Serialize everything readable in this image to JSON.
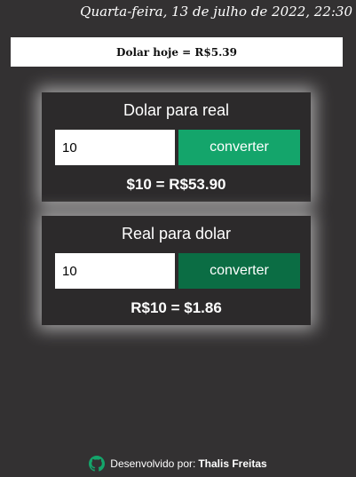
{
  "header": {
    "date": "Quarta-feira, 13 de julho de 2022, 22:30"
  },
  "rate_bar": {
    "text": "Dolar hoje = R$5.39"
  },
  "usd_to_brl": {
    "title": "Dolar para real",
    "input_value": "10",
    "button_label": "converter",
    "result": "$10 = R$53.90",
    "button_color": "#14a56b"
  },
  "brl_to_usd": {
    "title": "Real para dolar",
    "input_value": "10",
    "button_label": "converter",
    "result": "R$10 = $1.86",
    "button_color": "#0b6d44"
  },
  "footer": {
    "icon": "github-icon",
    "label": "Desenvolvido por:",
    "author": "Thalis Freitas",
    "icon_color": "#14a56b"
  },
  "colors": {
    "background": "#333132",
    "card_background": "#2c2a2b"
  }
}
